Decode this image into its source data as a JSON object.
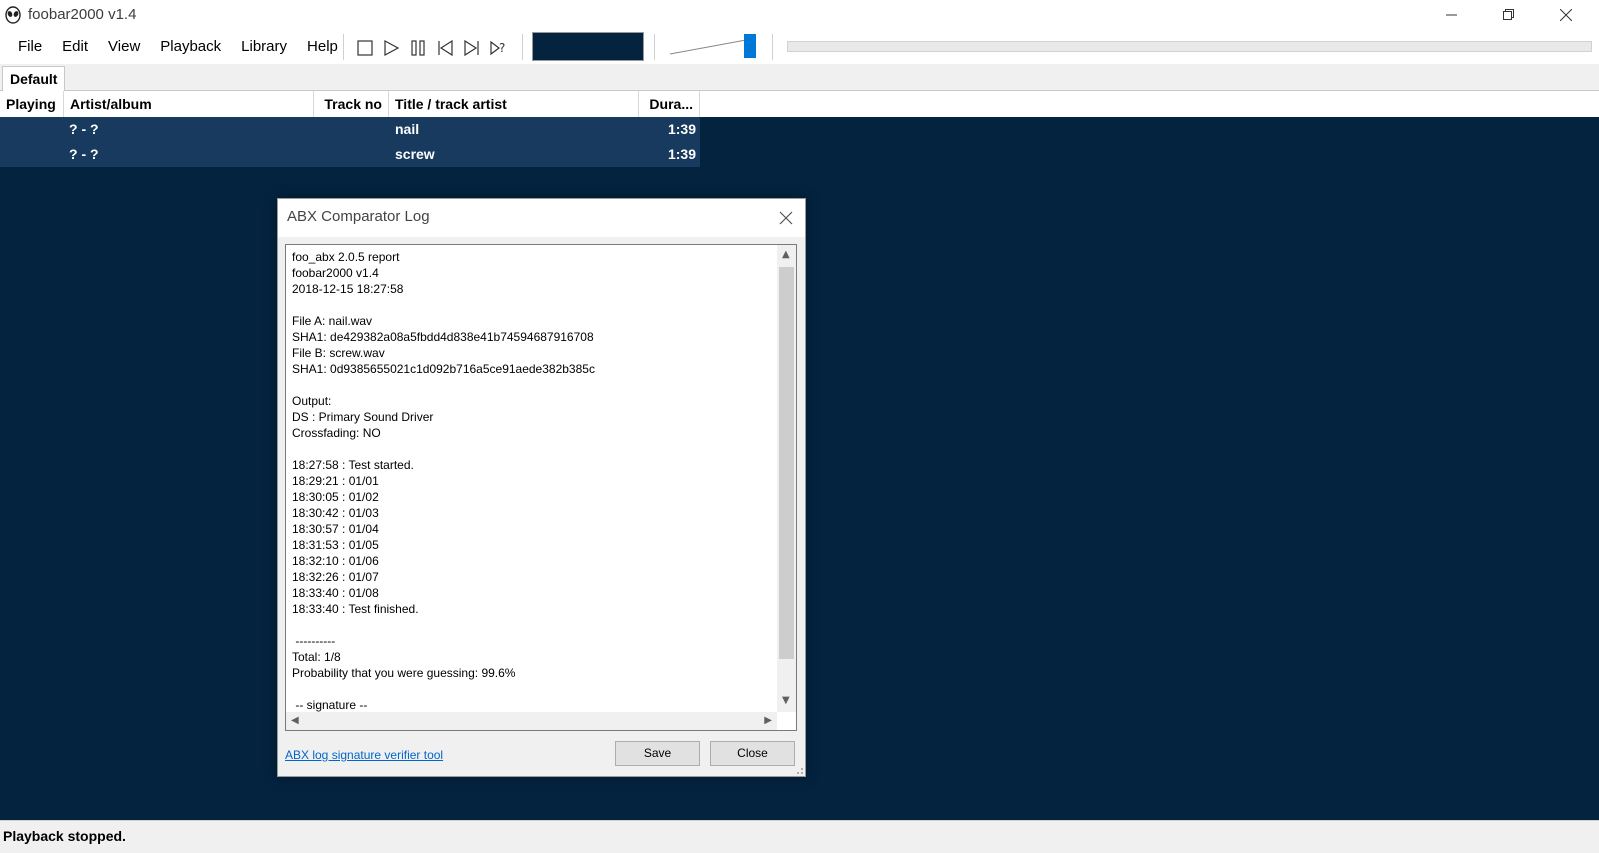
{
  "window": {
    "title": "foobar2000 v1.4"
  },
  "menu": [
    "File",
    "Edit",
    "View",
    "Playback",
    "Library",
    "Help"
  ],
  "tabs": [
    "Default"
  ],
  "columns": [
    "Playing",
    "Artist/album",
    "Track no",
    "Title / track artist",
    "Dura..."
  ],
  "rows": [
    {
      "playing": "",
      "artist_album": "? - ?",
      "track_no": "",
      "title": "nail",
      "duration": "1:39"
    },
    {
      "playing": "",
      "artist_album": "? - ?",
      "track_no": "",
      "title": "screw",
      "duration": "1:39"
    }
  ],
  "volume_level_pct": 100,
  "status": "Playback stopped.",
  "dialog": {
    "title": "ABX Comparator Log",
    "log": "foo_abx 2.0.5 report\nfoobar2000 v1.4\n2018-12-15 18:27:58\n\nFile A: nail.wav\nSHA1: de429382a08a5fbdd4d838e41b74594687916708\nFile B: screw.wav\nSHA1: 0d9385655021c1d092b716a5ce91aede382b385c\n\nOutput:\nDS : Primary Sound Driver\nCrossfading: NO\n\n18:27:58 : Test started.\n18:29:21 : 01/01\n18:30:05 : 01/02\n18:30:42 : 01/03\n18:30:57 : 01/04\n18:31:53 : 01/05\n18:32:10 : 01/06\n18:32:26 : 01/07\n18:33:40 : 01/08\n18:33:40 : Test finished.\n\n ----------\nTotal: 1/8\nProbability that you were guessing: 99.6%\n\n -- signature --",
    "link": "ABX log signature verifier tool",
    "save_label": "Save",
    "close_label": "Close"
  },
  "colors": {
    "playlist_bg": "#03233f",
    "selected_row": "#173a5e",
    "volume_thumb": "#0078d7",
    "link": "#0066cc"
  }
}
